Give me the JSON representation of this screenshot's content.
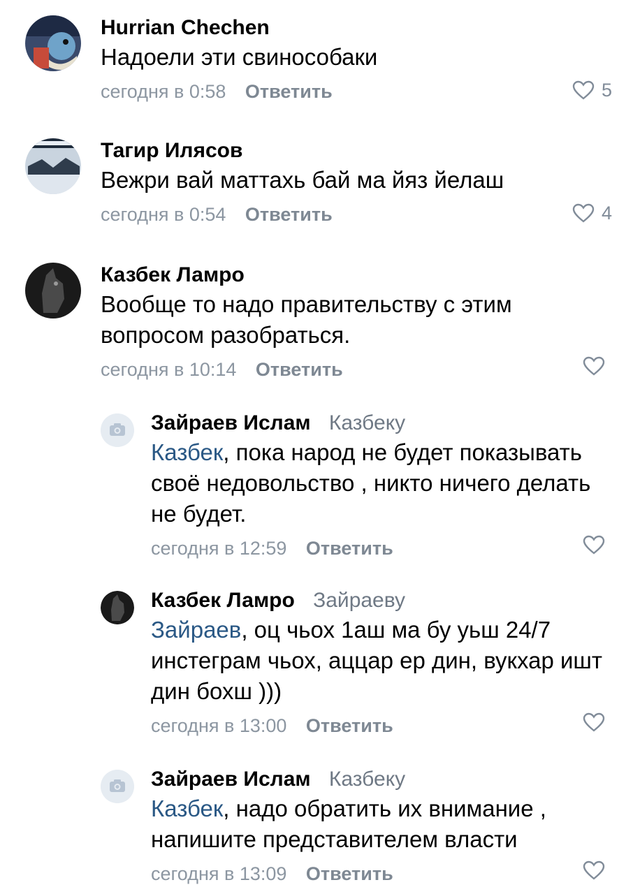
{
  "comments": [
    {
      "author": "Hurrian Chechen",
      "reply_to": "",
      "mention": "",
      "text": "Надоели эти свинособаки",
      "time": "сегодня в 0:58",
      "reply_label": "Ответить",
      "likes": "5",
      "avatar_icon": "user-avatar-icon"
    },
    {
      "author": "Тагир Илясов",
      "reply_to": "",
      "mention": "",
      "text": "Вежри вай маттахь бай ма йяз йелаш",
      "time": "сегодня в 0:54",
      "reply_label": "Ответить",
      "likes": "4",
      "avatar_icon": "user-avatar-icon"
    },
    {
      "author": "Казбек Ламро",
      "reply_to": "",
      "mention": "",
      "text": "Вообще то надо правительству  с этим вопросом разобраться.",
      "time": "сегодня в 10:14",
      "reply_label": "Ответить",
      "likes": "",
      "avatar_icon": "user-avatar-icon"
    },
    {
      "author": "Зайраев Ислам",
      "reply_to": "Казбеку",
      "mention": "Казбек",
      "text": ", пока народ не будет показывать своё недовольство  , никто ничего делать не будет.",
      "time": "сегодня в 12:59",
      "reply_label": "Ответить",
      "likes": "",
      "avatar_icon": "camera-placeholder-icon"
    },
    {
      "author": "Казбек Ламро",
      "reply_to": "Зайраеву",
      "mention": "Зайраев",
      "text": ", оц чьох 1аш ма бу уьш 24/7 инстеграм чьох, аццар  ер  дин,  вукхар ишт дин бохш )))",
      "time": "сегодня в 13:00",
      "reply_label": "Ответить",
      "likes": "",
      "avatar_icon": "user-avatar-icon"
    },
    {
      "author": "Зайраев Ислам",
      "reply_to": "Казбеку",
      "mention": "Казбек",
      "text": ", надо обратить их внимание , напишите представителем власти",
      "time": "сегодня в 13:09",
      "reply_label": "Ответить",
      "likes": "",
      "avatar_icon": "camera-placeholder-icon"
    }
  ],
  "colors": {
    "mention": "#2a5885",
    "meta": "#8c96a1",
    "like_icon": "#818c99"
  }
}
